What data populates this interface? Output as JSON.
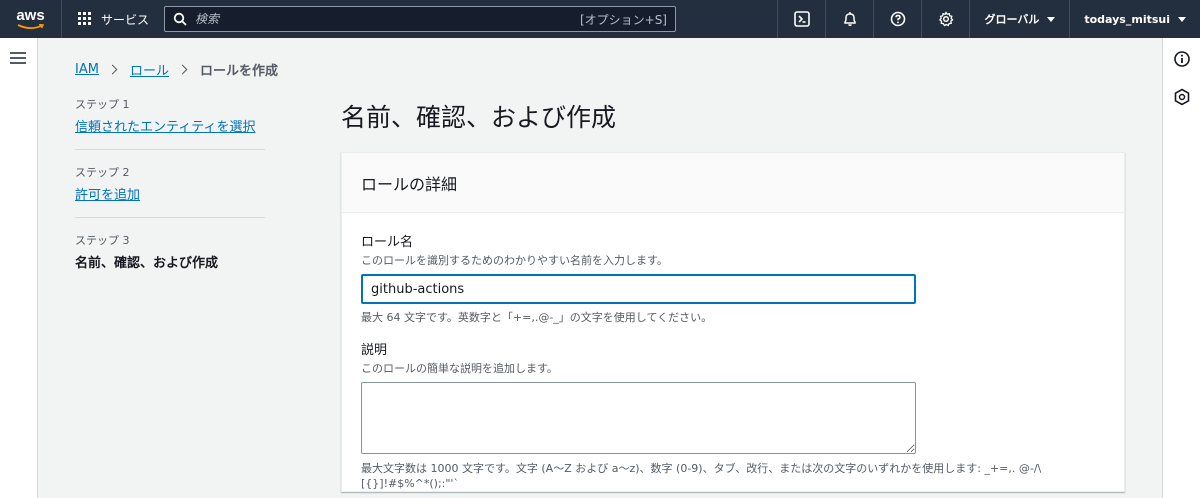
{
  "topnav": {
    "logo": "aws",
    "services_label": "サービス",
    "search_placeholder": "検索",
    "search_shortcut": "[オプション+S]",
    "region_label": "グローバル",
    "user_label": "todays_mitsui",
    "icons": [
      "cloudshell-icon",
      "bell-icon",
      "help-icon",
      "gear-icon"
    ]
  },
  "breadcrumb": {
    "items": [
      "IAM",
      "ロール",
      "ロールを作成"
    ]
  },
  "steps": [
    {
      "label": "ステップ 1",
      "title": "信頼されたエンティティを選択"
    },
    {
      "label": "ステップ 2",
      "title": "許可を追加"
    },
    {
      "label": "ステップ 3",
      "title": "名前、確認、および作成"
    }
  ],
  "main": {
    "title": "名前、確認、および作成",
    "card_title": "ロールの詳細",
    "role_name": {
      "label": "ロール名",
      "description": "このロールを識別するためのわかりやすい名前を入力します。",
      "value": "github-actions",
      "constraint": "最大 64 文字です。英数字と「+=,.@-_」の文字を使用してください。"
    },
    "description": {
      "label": "説明",
      "description": "このロールの簡単な説明を追加します。",
      "value": "",
      "constraint": "最大文字数は 1000 文字です。文字 (A〜Z および a〜z)、数字 (0-9)、タブ、改行、または次の文字のいずれかを使用します: _+=,. @-/\\[{}]!#$%^*();:\"'`"
    }
  },
  "colors": {
    "nav_bg": "#232f3e",
    "link": "#0073bb",
    "focus_border": "#0073bb"
  }
}
